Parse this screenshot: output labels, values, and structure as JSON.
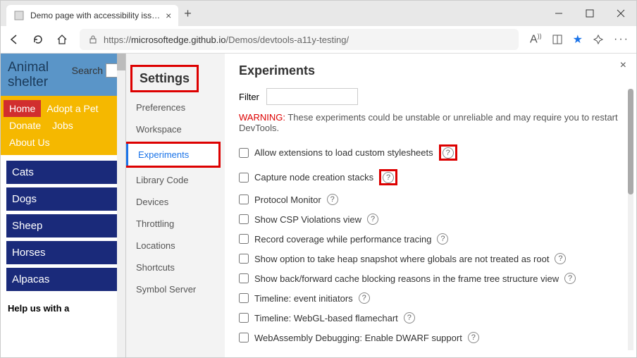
{
  "browser": {
    "tab_title": "Demo page with accessibility iss…",
    "url_prefix": "https://",
    "url_host": "microsoftedge.github.io",
    "url_path": "/Demos/devtools-a11y-testing/"
  },
  "page": {
    "brand_line1": "Animal",
    "brand_line2": "shelter",
    "search_label": "Search",
    "nav": [
      "Home",
      "Adopt a Pet",
      "Donate",
      "Jobs",
      "About Us"
    ],
    "side": [
      "Cats",
      "Dogs",
      "Sheep",
      "Horses",
      "Alpacas"
    ],
    "help_heading": "Help us with a"
  },
  "settings": {
    "title": "Settings",
    "items": [
      "Preferences",
      "Workspace",
      "Experiments",
      "Library Code",
      "Devices",
      "Throttling",
      "Locations",
      "Shortcuts",
      "Symbol Server"
    ],
    "selected": "Experiments"
  },
  "panel": {
    "title": "Experiments",
    "filter_label": "Filter",
    "warning_label": "WARNING:",
    "warning_text": "These experiments could be unstable or unreliable and may require you to restart DevTools.",
    "experiments": [
      {
        "label": "Allow extensions to load custom stylesheets",
        "hl": true
      },
      {
        "label": "Capture node creation stacks",
        "hl": true
      },
      {
        "label": "Protocol Monitor"
      },
      {
        "label": "Show CSP Violations view"
      },
      {
        "label": "Record coverage while performance tracing"
      },
      {
        "label": "Show option to take heap snapshot where globals are not treated as root"
      },
      {
        "label": "Show back/forward cache blocking reasons in the frame tree structure view"
      },
      {
        "label": "Timeline: event initiators"
      },
      {
        "label": "Timeline: WebGL-based flamechart"
      },
      {
        "label": "WebAssembly Debugging: Enable DWARF support"
      }
    ]
  }
}
